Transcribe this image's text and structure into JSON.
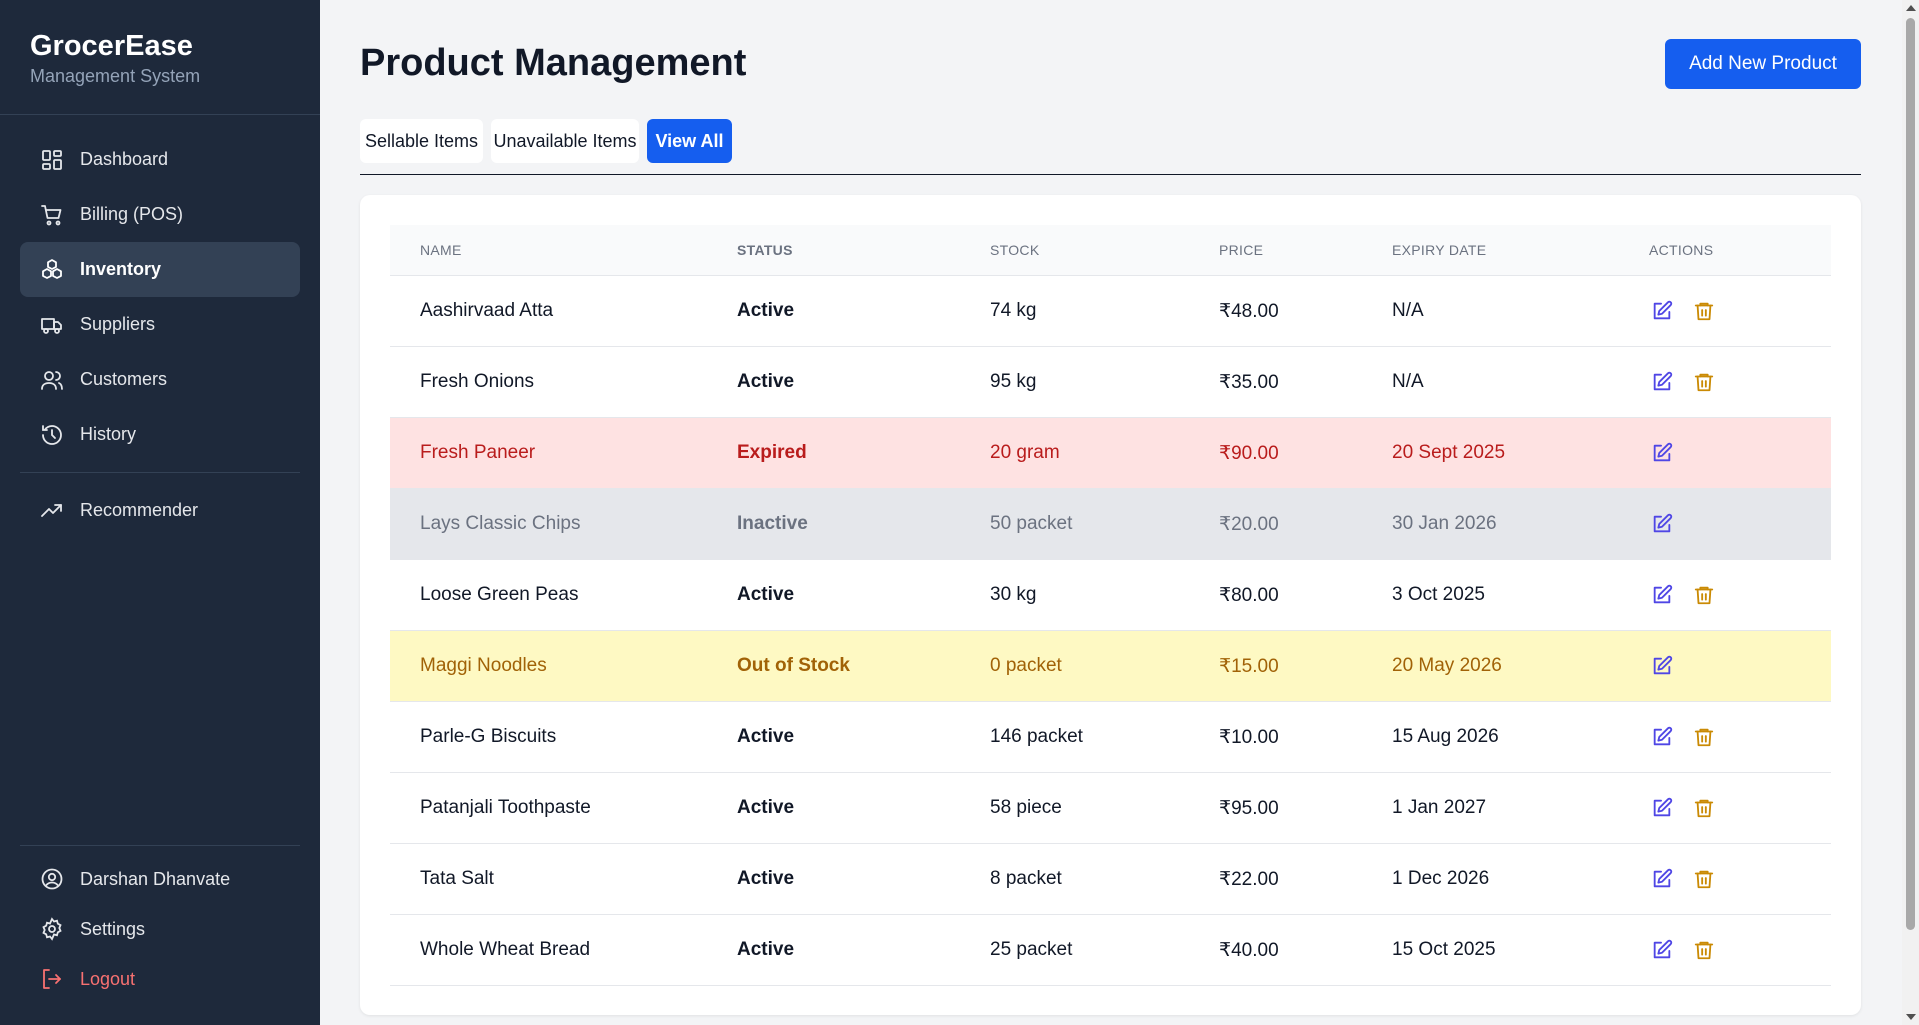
{
  "brand": {
    "title": "GrocerEase",
    "subtitle": "Management System"
  },
  "sidebar": {
    "items": [
      {
        "label": "Dashboard",
        "icon": "dashboard-icon"
      },
      {
        "label": "Billing (POS)",
        "icon": "cart-icon"
      },
      {
        "label": "Inventory",
        "icon": "inventory-icon",
        "active": true
      },
      {
        "label": "Suppliers",
        "icon": "truck-icon"
      },
      {
        "label": "Customers",
        "icon": "users-icon"
      },
      {
        "label": "History",
        "icon": "history-icon"
      }
    ],
    "secondary": [
      {
        "label": "Recommender",
        "icon": "trending-icon"
      }
    ],
    "bottom": [
      {
        "label": "Darshan Dhanvate",
        "icon": "user-circle-icon"
      },
      {
        "label": "Settings",
        "icon": "gear-icon"
      },
      {
        "label": "Logout",
        "icon": "logout-icon"
      }
    ]
  },
  "header": {
    "title": "Product Management",
    "add_button": "Add New Product"
  },
  "tabs": [
    {
      "label": "Sellable Items"
    },
    {
      "label": "Unavailable Items"
    },
    {
      "label": "View All",
      "active": true
    }
  ],
  "table": {
    "columns": [
      "NAME",
      "STATUS",
      "STOCK",
      "PRICE",
      "EXPIRY DATE",
      "ACTIONS"
    ],
    "rows": [
      {
        "name": "Aashirvaad Atta",
        "status": "Active",
        "stock": "74 kg",
        "price": "₹48.00",
        "expiry": "N/A",
        "state": "normal"
      },
      {
        "name": "Fresh Onions",
        "status": "Active",
        "stock": "95 kg",
        "price": "₹35.00",
        "expiry": "N/A",
        "state": "normal"
      },
      {
        "name": "Fresh Paneer",
        "status": "Expired",
        "stock": "20 gram",
        "price": "₹90.00",
        "expiry": "20 Sept 2025",
        "state": "expired"
      },
      {
        "name": "Lays Classic Chips",
        "status": "Inactive",
        "stock": "50 packet",
        "price": "₹20.00",
        "expiry": "30 Jan 2026",
        "state": "inactive"
      },
      {
        "name": "Loose Green Peas",
        "status": "Active",
        "stock": "30 kg",
        "price": "₹80.00",
        "expiry": "3 Oct 2025",
        "state": "normal"
      },
      {
        "name": "Maggi Noodles",
        "status": "Out of Stock",
        "stock": "0 packet",
        "price": "₹15.00",
        "expiry": "20 May 2026",
        "state": "oos"
      },
      {
        "name": "Parle-G Biscuits",
        "status": "Active",
        "stock": "146 packet",
        "price": "₹10.00",
        "expiry": "15 Aug 2026",
        "state": "normal"
      },
      {
        "name": "Patanjali Toothpaste",
        "status": "Active",
        "stock": "58 piece",
        "price": "₹95.00",
        "expiry": "1 Jan 2027",
        "state": "normal"
      },
      {
        "name": "Tata Salt",
        "status": "Active",
        "stock": "8 packet",
        "price": "₹22.00",
        "expiry": "1 Dec 2026",
        "state": "normal"
      },
      {
        "name": "Whole Wheat Bread",
        "status": "Active",
        "stock": "25 packet",
        "price": "₹40.00",
        "expiry": "15 Oct 2025",
        "state": "normal"
      }
    ]
  },
  "colors": {
    "sidebar_bg": "#1e293b",
    "primary": "#155eef",
    "expired_bg": "#fee2e2",
    "inactive_bg": "#e5e7eb",
    "out_of_stock_bg": "#fef9c3",
    "edit_icon": "#4f46e5",
    "delete_icon": "#ca8a04",
    "logout": "#f87171"
  }
}
